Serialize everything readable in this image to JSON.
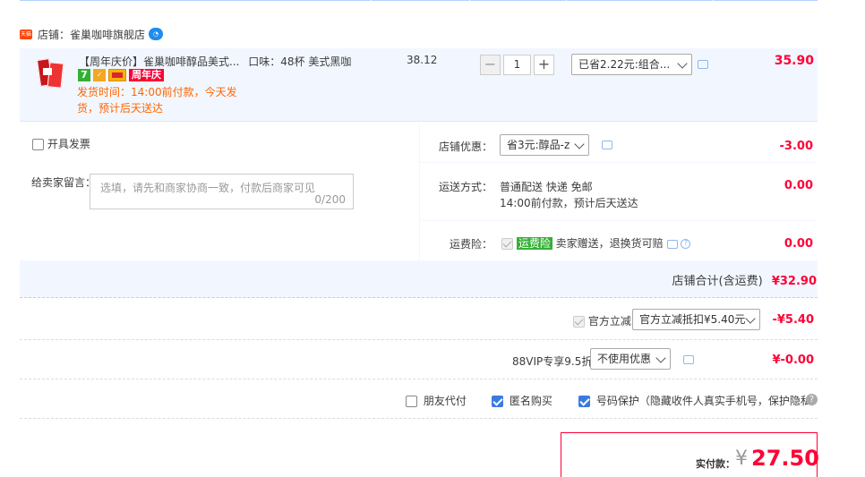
{
  "shop": {
    "label": "店铺：雀巢咖啡旗舰店",
    "badge_text": "天猫"
  },
  "item": {
    "title": "【周年庆价】雀巢咖啡醇品美式...",
    "flavor": "口味：48杯 美式黑咖",
    "badge_seven": "7",
    "badge_event": "周年庆",
    "ship_line1": "发货时间：14:00前付款，今天发",
    "ship_line2": "货，预计后天送达",
    "unit_price": "38.12",
    "quantity": "1",
    "promo_select": "已省2.22元:组合...",
    "subtotal": "35.90"
  },
  "options": {
    "invoice_label": "开具发票",
    "message_label": "给卖家留言：",
    "message_placeholder": "选填，请先和商家协商一致，付款后商家可见",
    "message_count": "0/200",
    "shop_discount_label": "店铺优惠：",
    "shop_discount_select": "省3元:醇品-z",
    "shop_discount_amount": "-3.00",
    "delivery_label": "运送方式：",
    "delivery_method": "普通配送 快递 免邮",
    "delivery_time": "14:00前付款，预计后天送达",
    "delivery_amount": "0.00",
    "insurance_label": "运费险：",
    "insurance_tag": "运费险",
    "insurance_text": "卖家赠送，退换货可赔",
    "insurance_amount": "0.00",
    "shop_total_label": "店铺合计(含运费)",
    "shop_total": "¥32.90"
  },
  "official": {
    "label": "官方立减",
    "select": "官方立减抵扣¥5.40元",
    "amount": "-¥5.40"
  },
  "vip": {
    "label": "88VIP专享9.5折",
    "select": "不使用优惠",
    "amount": "¥-0.00"
  },
  "checks": {
    "friend_pay": "朋友代付",
    "anonymous": "匿名购买",
    "number_protect": "号码保护（隐藏收件人真实手机号，保护隐私）"
  },
  "pay": {
    "label": "实付款：",
    "currency": "¥",
    "amount": "27.50"
  },
  "colors": {
    "accent_red": "#ff0036",
    "ship_orange": "#ff6600",
    "row_bg": "#f2f7ff"
  }
}
